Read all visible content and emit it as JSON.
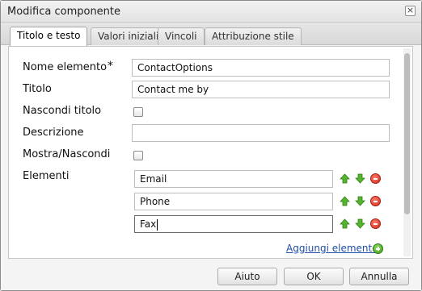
{
  "dialog": {
    "title": "Modifica componente",
    "close_icon": "close-icon"
  },
  "tabs": [
    {
      "label": "Titolo e testo",
      "active": true
    },
    {
      "label": "Valori iniziali",
      "active": false
    },
    {
      "label": "Vincoli",
      "active": false
    },
    {
      "label": "Attribuzione stile",
      "active": false
    }
  ],
  "form": {
    "nome_elemento": {
      "label": "Nome elemento",
      "required_mark": "*",
      "value": "ContactOptions"
    },
    "titolo": {
      "label": "Titolo",
      "value": "Contact me by"
    },
    "nascondi_titolo": {
      "label": "Nascondi titolo",
      "checked": false
    },
    "descrizione": {
      "label": "Descrizione",
      "value": ""
    },
    "mostra_nascondi": {
      "label": "Mostra/Nascondi",
      "checked": false
    },
    "elementi": {
      "label": "Elementi",
      "items": [
        {
          "value": "Email"
        },
        {
          "value": "Phone"
        },
        {
          "value": "Fax"
        }
      ],
      "add_label": "Aggiungi elemento",
      "icons": {
        "up": "arrow-up-icon",
        "down": "arrow-down-icon",
        "remove": "remove-icon",
        "add": "add-icon"
      }
    }
  },
  "buttons": {
    "help": "Aiuto",
    "ok": "OK",
    "cancel": "Annulla"
  },
  "colors": {
    "link": "#1f4fa8",
    "arrow_green": "#4caf2a",
    "remove_red": "#d42a1a"
  }
}
